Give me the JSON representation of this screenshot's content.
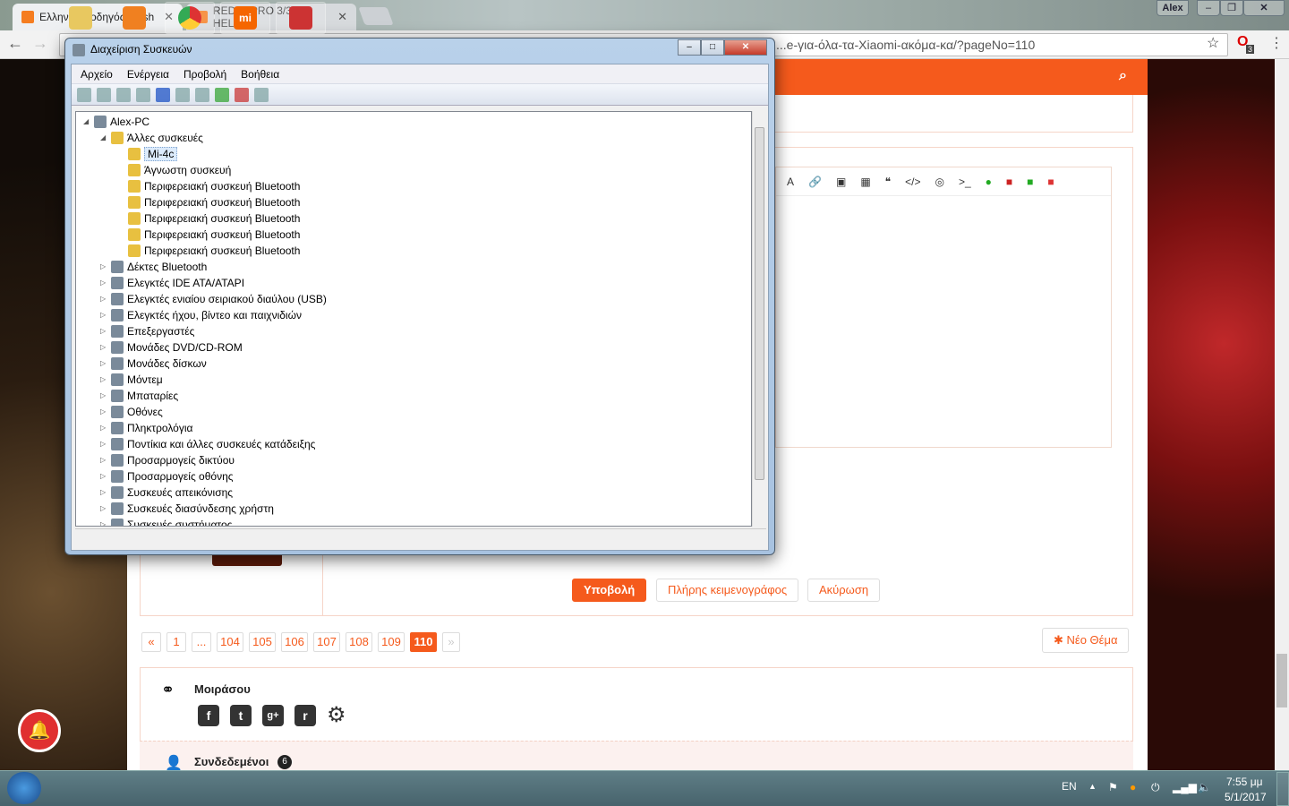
{
  "browser": {
    "tabs": [
      {
        "title": "Ελληνικός οδηγός Flash",
        "active": true
      },
      {
        "title": "REDMI PRO 3/32 HELIO",
        "active": false
      }
    ],
    "profile": "Alex",
    "url": "...e-για-όλα-τα-Xiaomi-ακόμα-κα/?pageNo=110",
    "extension_badge": "3"
  },
  "device_manager": {
    "title": "Διαχείριση Συσκευών",
    "menu": [
      "Αρχείο",
      "Ενέργεια",
      "Προβολή",
      "Βοήθεια"
    ],
    "tree": [
      {
        "label": "Alex-PC",
        "level": 0,
        "expand": "◢"
      },
      {
        "label": "Άλλες συσκευές",
        "level": 1,
        "expand": "◢",
        "warn": true
      },
      {
        "label": "Mi-4c",
        "level": 2,
        "warn": true,
        "selected": true
      },
      {
        "label": "Άγνωστη συσκευή",
        "level": 2,
        "warn": true
      },
      {
        "label": "Περιφερειακή συσκευή Bluetooth",
        "level": 2,
        "warn": true
      },
      {
        "label": "Περιφερειακή συσκευή Bluetooth",
        "level": 2,
        "warn": true
      },
      {
        "label": "Περιφερειακή συσκευή Bluetooth",
        "level": 2,
        "warn": true
      },
      {
        "label": "Περιφερειακή συσκευή Bluetooth",
        "level": 2,
        "warn": true
      },
      {
        "label": "Περιφερειακή συσκευή Bluetooth",
        "level": 2,
        "warn": true
      },
      {
        "label": "Δέκτες Bluetooth",
        "level": 1,
        "expand": "▷"
      },
      {
        "label": "Ελεγκτές IDE ATA/ATAPI",
        "level": 1,
        "expand": "▷"
      },
      {
        "label": "Ελεγκτές ενιαίου σειριακού διαύλου (USB)",
        "level": 1,
        "expand": "▷"
      },
      {
        "label": "Ελεγκτές ήχου, βίντεο και παιχνιδιών",
        "level": 1,
        "expand": "▷"
      },
      {
        "label": "Επεξεργαστές",
        "level": 1,
        "expand": "▷"
      },
      {
        "label": "Μονάδες DVD/CD-ROM",
        "level": 1,
        "expand": "▷"
      },
      {
        "label": "Μονάδες δίσκων",
        "level": 1,
        "expand": "▷"
      },
      {
        "label": "Μόντεμ",
        "level": 1,
        "expand": "▷"
      },
      {
        "label": "Μπαταρίες",
        "level": 1,
        "expand": "▷"
      },
      {
        "label": "Οθόνες",
        "level": 1,
        "expand": "▷"
      },
      {
        "label": "Πληκτρολόγια",
        "level": 1,
        "expand": "▷"
      },
      {
        "label": "Ποντίκια και άλλες συσκευές κατάδειξης",
        "level": 1,
        "expand": "▷"
      },
      {
        "label": "Προσαρμογείς δικτύου",
        "level": 1,
        "expand": "▷"
      },
      {
        "label": "Προσαρμογείς οθόνης",
        "level": 1,
        "expand": "▷"
      },
      {
        "label": "Συσκευές απεικόνισης",
        "level": 1,
        "expand": "▷"
      },
      {
        "label": "Συσκευές διασύνδεσης χρήστη",
        "level": 1,
        "expand": "▷"
      },
      {
        "label": "Συσκευές συστήματος",
        "level": 1,
        "expand": "▷"
      }
    ]
  },
  "forum": {
    "submit": "Υποβολή",
    "full_editor": "Πλήρης κειμενογράφος",
    "cancel": "Ακύρωση",
    "pagination": [
      "«",
      "1",
      "...",
      "104",
      "105",
      "106",
      "107",
      "108",
      "109",
      "110",
      "»"
    ],
    "current_page": "110",
    "new_topic": "Νέο Θέμα",
    "share_title": "Μοιράσου",
    "online_title": "Συνδεδεμένοι",
    "online_count": "6"
  },
  "taskbar": {
    "lang": "EN",
    "time": "7:55 μμ",
    "date": "5/1/2017"
  }
}
